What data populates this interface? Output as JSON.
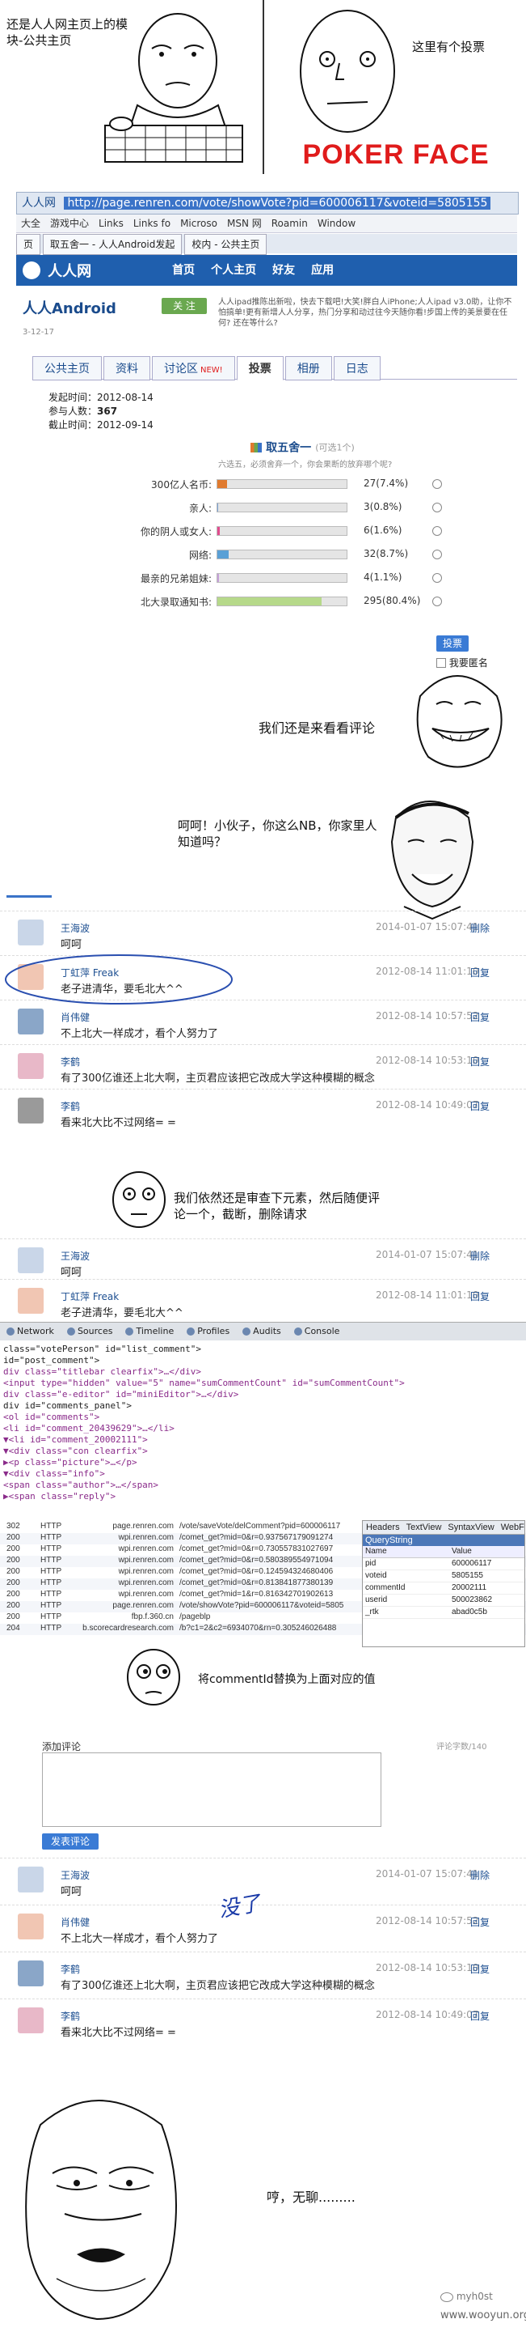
{
  "panel1": {
    "left_caption": "还是人人网主页上的模块-公共主页",
    "right_caption": "这里有个投票",
    "poker_face_label": "POKER FACE"
  },
  "browser": {
    "address_label": "人人网",
    "url": "http://page.renren.com/vote/showVote?pid=600006117&voteid=5805155",
    "favorites": [
      "大全",
      "游戏中心",
      "Links",
      "Links fo",
      "Microso",
      "MSN 网",
      "Roamin",
      "Window"
    ],
    "tabs": [
      "页",
      "取五舍一 - 人人Android发起",
      "校内 - 公共主页"
    ],
    "site_name": "人人网",
    "nav_items": [
      "首页",
      "个人主页",
      "好友",
      "应用"
    ],
    "page_title": "人人Android",
    "follow_label": "关 注",
    "promo_text": "人人ipad推陈出新啦，快去下载吧!大笑!胖白人iPhone;人人ipad v3.0助，让你不怕搞单!更有新增人人分享，热门分享和动过往今天随你看!步国上传的美景要在任何? 还在等什么?",
    "promo_date": "3-12-17",
    "page_tabs": [
      "公共主页",
      "资料",
      "讨论区",
      "投票",
      "相册",
      "日志"
    ],
    "new_badge": "NEW!",
    "vote_meta": [
      {
        "label": "发起时间：",
        "value": "2012-08-14"
      },
      {
        "label": "参与人数：",
        "value": "367"
      },
      {
        "label": "截止时间：",
        "value": "2012-09-14"
      }
    ],
    "vote_title": "取五舍一",
    "vote_sub": "(可选1个)",
    "vote_desc": "六选五，必须舍弃一个，你会果断的放弃哪个呢?",
    "options": [
      {
        "label": "300亿人名币:",
        "result": "27(7.4%)",
        "pct": 7.4,
        "color": "#e07a2e"
      },
      {
        "label": "亲人:",
        "result": "3(0.8%)",
        "pct": 0.8,
        "color": "#7aa3d6"
      },
      {
        "label": "你的阴人或女人:",
        "result": "6(1.6%)",
        "pct": 1.6,
        "color": "#e24b8e"
      },
      {
        "label": "网络:",
        "result": "32(8.7%)",
        "pct": 8.7,
        "color": "#5aa0d6"
      },
      {
        "label": "最亲的兄弟姐妹:",
        "result": "4(1.1%)",
        "pct": 1.1,
        "color": "#c6a0d9"
      },
      {
        "label": "北大录取通知书:",
        "result": "295(80.4%)",
        "pct": 80.4,
        "color": "#b6d98a"
      }
    ],
    "vote_button": "投票",
    "anonymous_label": "我要匿名",
    "caption": "我们还是来看看评论"
  },
  "panel3": {
    "caption": "呵呵！小伙子，你这么NB，你家里人知道吗？",
    "comments": [
      {
        "name": "王海波",
        "text": "呵呵",
        "time": "2014-01-07 15:07:41",
        "reply": "删除"
      },
      {
        "name": "丁虹萍 Freak",
        "text": "老子进清华，要毛北大^^",
        "time": "2012-08-14 11:01:10",
        "reply": "回复"
      },
      {
        "name": "肖伟健",
        "text": "不上北大一样成才，看个人努力了",
        "time": "2012-08-14 10:57:52",
        "reply": "回复"
      },
      {
        "name": "李鹤",
        "text": "有了300亿谁还上北大啊，主页君应该把它改成大学这种模糊的概念",
        "time": "2012-08-14 10:53:10",
        "reply": "回复"
      },
      {
        "name": "李鹤",
        "text": "看来北大比不过网络= =",
        "time": "2012-08-14 10:49:07",
        "reply": "回复"
      }
    ]
  },
  "panel4": {
    "caption": "我们依然还是审查下元素，然后随便评论一个，截断，删除请求",
    "comments": [
      {
        "name": "王海波",
        "text": "呵呵",
        "time": "2014-01-07 15:07:41",
        "reply": "删除"
      },
      {
        "name": "丁虹萍 Freak",
        "text": "老子进清华，要毛北大^^",
        "time": "2012-08-14 11:01:10",
        "reply": "回复"
      }
    ],
    "devtabs": [
      "Network",
      "Sources",
      "Timeline",
      "Profiles",
      "Audits",
      "Console"
    ],
    "code_lines": [
      "class=\"votePerson\" id=\"list_comment\">",
      " id=\"post_comment\">",
      " div class=\"titlebar clearfix\">…</div>",
      "<input type=\"hidden\" value=\"5\" name=\"sumCommentCount\" id=\"sumCommentCount\">",
      " div class=\"e-editor\" id=\"miniEditor\">…</div>",
      " div id=\"comments_panel\">",
      "  <ol id=\"comments\">",
      "   <li id=\"comment_20439629\">…</li>",
      "  ▼<li id=\"comment_20002111\">",
      "   ▼<div class=\"con clearfix\">",
      "     ▶<p class=\"picture\">…</p>",
      "     ▼<div class=\"info\">",
      "        <span class=\"author\">…</span>",
      "      ▶<span class=\"reply\">"
    ],
    "net_rows": [
      {
        "status": "302",
        "type": "HTTP",
        "host": "page.renren.com",
        "path": "/vote/saveVote/delComment?pid=600006117"
      },
      {
        "status": "200",
        "type": "HTTP",
        "host": "wpi.renren.com",
        "path": "/comet_get?mid=0&r=0.937567179091274"
      },
      {
        "status": "200",
        "type": "HTTP",
        "host": "wpi.renren.com",
        "path": "/comet_get?mid=0&r=0.730557831027697"
      },
      {
        "status": "200",
        "type": "HTTP",
        "host": "wpi.renren.com",
        "path": "/comet_get?mid=0&r=0.580389554971094"
      },
      {
        "status": "200",
        "type": "HTTP",
        "host": "wpi.renren.com",
        "path": "/comet_get?mid=0&r=0.124594324680406"
      },
      {
        "status": "200",
        "type": "HTTP",
        "host": "wpi.renren.com",
        "path": "/comet_get?mid=0&r=0.813841877380139"
      },
      {
        "status": "200",
        "type": "HTTP",
        "host": "wpi.renren.com",
        "path": "/comet_get?mid=1&r=0.816342701902613"
      },
      {
        "status": "200",
        "type": "HTTP",
        "host": "page.renren.com",
        "path": "/vote/showVote?pid=600006117&voteid=5805"
      },
      {
        "status": "200",
        "type": "HTTP",
        "host": "fbp.f.360.cn",
        "path": "/pageblp"
      },
      {
        "status": "204",
        "type": "HTTP",
        "host": "b.scorecardresearch.com",
        "path": "/b?c1=2&c2=6934070&rn=0.305246026488"
      }
    ],
    "inspector_tabs": [
      "Headers",
      "TextView",
      "SyntaxView",
      "WebForms"
    ],
    "query_title": "QueryString",
    "query_headers": [
      "Name",
      "Value"
    ],
    "query_rows": [
      {
        "name": "pid",
        "value": "600006117"
      },
      {
        "name": "voteid",
        "value": "5805155"
      },
      {
        "name": "commentId",
        "value": "20002111"
      },
      {
        "name": "userid",
        "value": "500023862"
      },
      {
        "name": "_rtk",
        "value": "abad0c5b"
      }
    ],
    "caption2": "将commentId替换为上面对应的值"
  },
  "panel5": {
    "box_label": "添加评论",
    "counter": "评论字数/140",
    "submit_label": "发表评论",
    "handwritten": "没了",
    "comments": [
      {
        "name": "王海波",
        "text": "呵呵",
        "time": "2014-01-07 15:07:41",
        "reply": "删除"
      },
      {
        "name": "肖伟健",
        "text": "不上北大一样成才，看个人努力了",
        "time": "2012-08-14 10:57:52",
        "reply": "回复"
      },
      {
        "name": "李鹤",
        "text": "有了300亿谁还上北大啊，主页君应该把它改成大学这种模糊的概念",
        "time": "2012-08-14 10:53:10",
        "reply": "回复"
      },
      {
        "name": "李鹤",
        "text": "看来北大比不过网络= =",
        "time": "2012-08-14 10:49:07",
        "reply": "回复"
      }
    ]
  },
  "panel6": {
    "caption": "哼，无聊.........",
    "watermark1": "myh0st",
    "watermark2": "www.wooyun.org"
  }
}
